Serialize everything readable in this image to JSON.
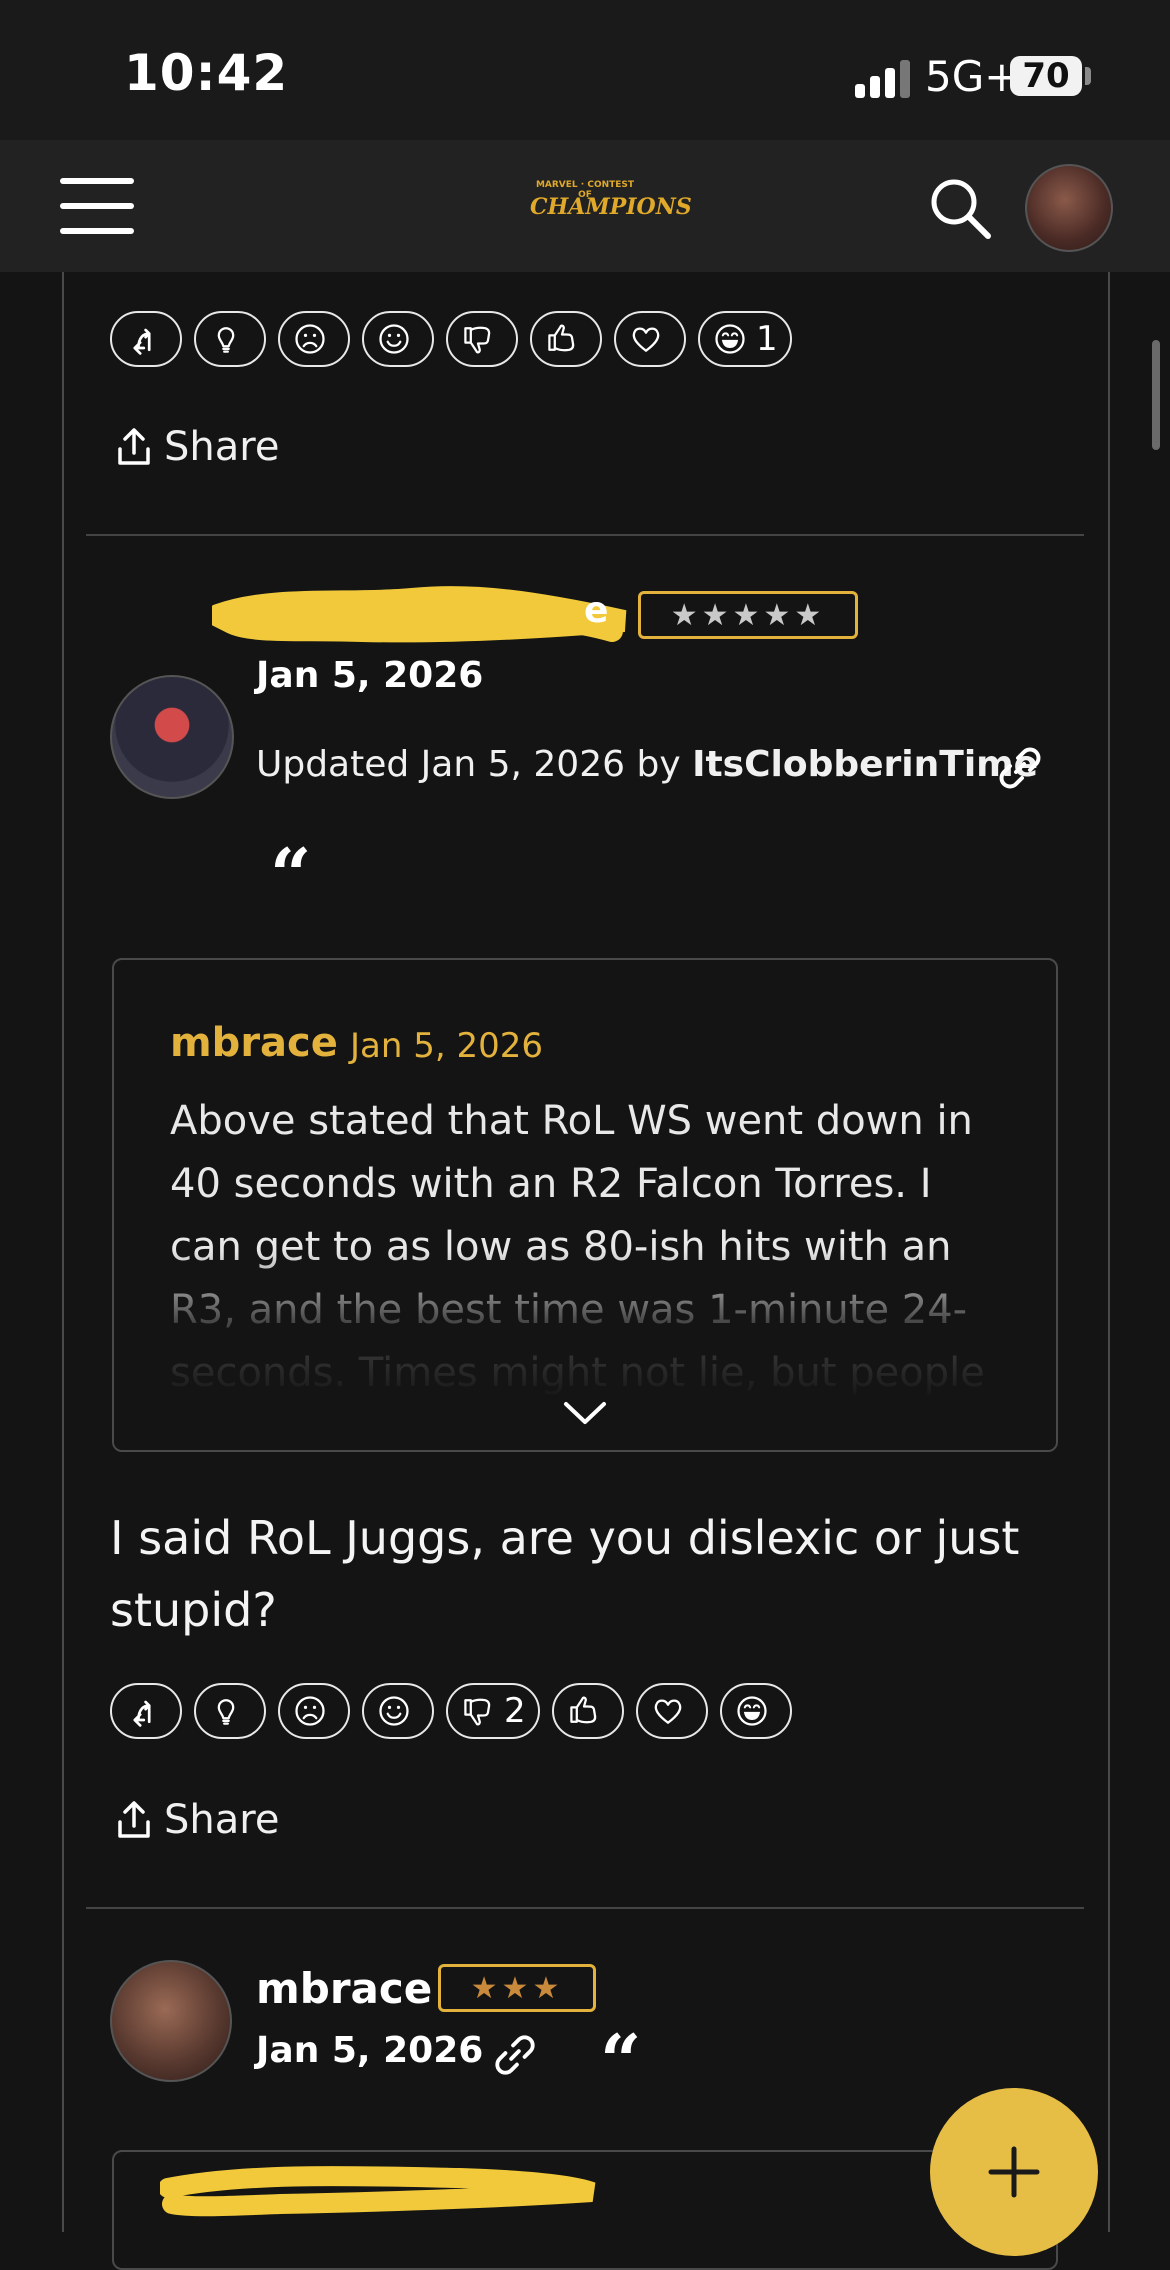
{
  "status_bar": {
    "time": "10:42",
    "network": "5G+",
    "battery": "70"
  },
  "header": {
    "logo_top": "MARVEL · CONTEST OF",
    "logo_main": "CHAMPIONS"
  },
  "post_top": {
    "reactions": [
      {
        "icon": "reply-icon",
        "count": ""
      },
      {
        "icon": "lightbulb-icon",
        "count": ""
      },
      {
        "icon": "sad-face-icon",
        "count": ""
      },
      {
        "icon": "smile-face-icon",
        "count": ""
      },
      {
        "icon": "thumbs-down-icon",
        "count": ""
      },
      {
        "icon": "thumbs-up-icon",
        "count": ""
      },
      {
        "icon": "heart-icon",
        "count": ""
      },
      {
        "icon": "laugh-face-icon",
        "count": "1"
      }
    ],
    "share_label": "Share"
  },
  "post1": {
    "author_visible_tail": "e",
    "rank_stars": "★★★★★",
    "date": "Jan 5, 2026",
    "updated_prefix": "Updated Jan 5, 2026 by ",
    "updated_by": "ItsClobberinTime",
    "quote": {
      "author": "mbrace",
      "date": "Jan 5, 2026",
      "text": "Above stated that RoL WS went down in 40 seconds with an R2 Falcon Torres. I can get to as low as 80-ish hits with an R3, and the best time was 1-minute 24-seconds. Times might not lie, but people do. I"
    },
    "body": "I said RoL Juggs, are you dislexic or just stupid?",
    "reactions": [
      {
        "icon": "reply-icon",
        "count": ""
      },
      {
        "icon": "lightbulb-icon",
        "count": ""
      },
      {
        "icon": "sad-face-icon",
        "count": ""
      },
      {
        "icon": "smile-face-icon",
        "count": ""
      },
      {
        "icon": "thumbs-down-icon",
        "count": "2"
      },
      {
        "icon": "thumbs-up-icon",
        "count": ""
      },
      {
        "icon": "heart-icon",
        "count": ""
      },
      {
        "icon": "laugh-face-icon",
        "count": ""
      }
    ],
    "share_label": "Share"
  },
  "post2": {
    "author": "mbrace",
    "rank_stars": "★★★",
    "date": "Jan 5, 2026"
  },
  "colors": {
    "accent": "#e3b23c",
    "background": "#141414",
    "header": "#222222",
    "fab": "#e6bd45"
  }
}
